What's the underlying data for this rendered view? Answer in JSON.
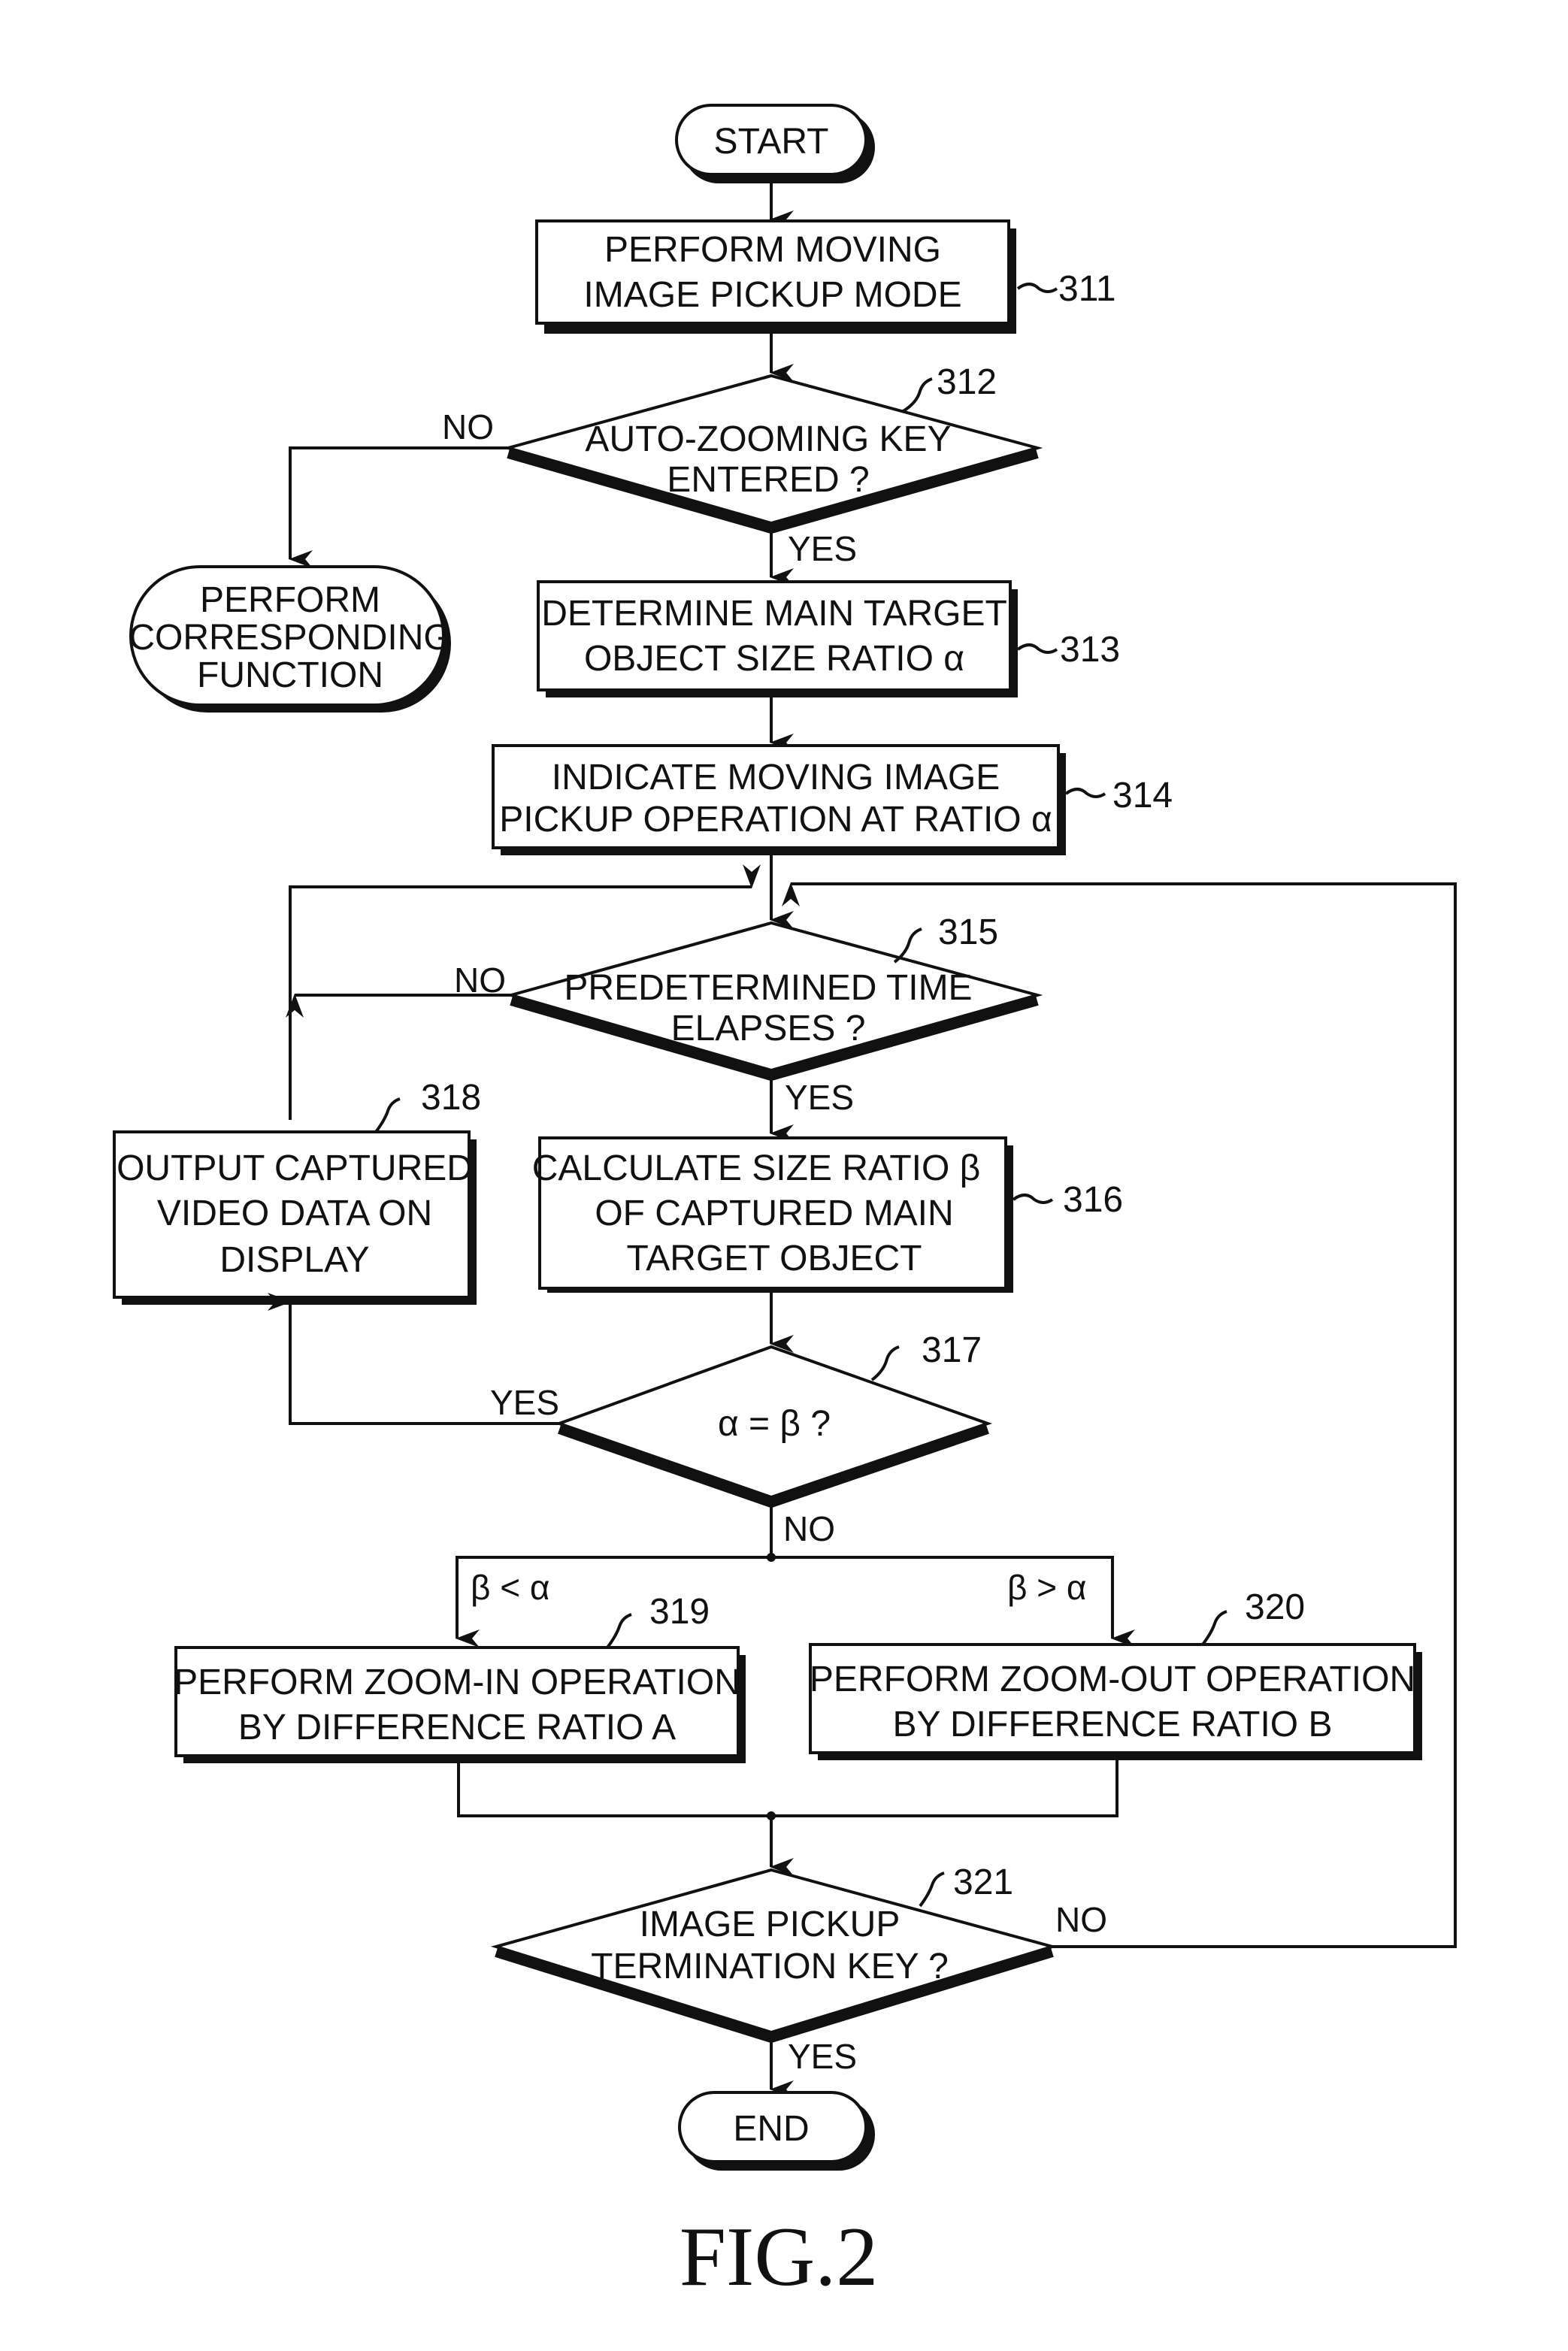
{
  "figure": {
    "caption": "FIG.2",
    "nodes": {
      "start": {
        "label": "START"
      },
      "s311": {
        "ref": "311",
        "lines": [
          "PERFORM MOVING",
          "IMAGE PICKUP MODE"
        ]
      },
      "s312": {
        "ref": "312",
        "lines": [
          "AUTO-ZOOMING KEY",
          "ENTERED ?"
        ],
        "yes": "YES",
        "no": "NO"
      },
      "corresponding": {
        "lines": [
          "PERFORM",
          "CORRESPONDING",
          "FUNCTION"
        ]
      },
      "s313": {
        "ref": "313",
        "lines": [
          "DETERMINE MAIN TARGET",
          "OBJECT SIZE RATIO α"
        ]
      },
      "s314": {
        "ref": "314",
        "lines": [
          "INDICATE MOVING IMAGE",
          "PICKUP OPERATION AT RATIO α"
        ]
      },
      "s315": {
        "ref": "315",
        "lines": [
          "PREDETERMINED TIME",
          "ELAPSES ?"
        ],
        "yes": "YES",
        "no": "NO"
      },
      "s316": {
        "ref": "316",
        "lines": [
          "CALCULATE SIZE RATIO  β",
          "OF CAPTURED MAIN",
          "TARGET OBJECT"
        ]
      },
      "s317": {
        "ref": "317",
        "lines": [
          "α = β ?"
        ],
        "yes": "YES",
        "no": "NO"
      },
      "s318": {
        "ref": "318",
        "lines": [
          "OUTPUT CAPTURED",
          "VIDEO DATA ON",
          "DISPLAY"
        ]
      },
      "branch_left": {
        "label": "β < α"
      },
      "branch_right": {
        "label": "β > α"
      },
      "s319": {
        "ref": "319",
        "lines": [
          "PERFORM ZOOM-IN OPERATION",
          "BY DIFFERENCE RATIO A"
        ]
      },
      "s320": {
        "ref": "320",
        "lines": [
          "PERFORM ZOOM-OUT OPERATION",
          "BY DIFFERENCE RATIO B"
        ]
      },
      "s321": {
        "ref": "321",
        "lines": [
          "IMAGE PICKUP",
          "TERMINATION KEY ?"
        ],
        "yes": "YES",
        "no": "NO"
      },
      "end": {
        "label": "END"
      }
    }
  }
}
